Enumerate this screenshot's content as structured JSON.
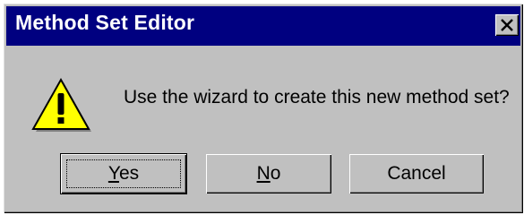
{
  "window": {
    "title": "Method Set Editor",
    "close_icon": "close-icon"
  },
  "dialog": {
    "icon": "warning-icon",
    "message": "Use the wizard to create this new method set?"
  },
  "buttons": {
    "yes": {
      "mnemonic": "Y",
      "rest": "es"
    },
    "no": {
      "mnemonic": "N",
      "rest": "o"
    },
    "cancel": {
      "label": "Cancel"
    }
  },
  "colors": {
    "titlebar": "#000080",
    "face": "#c0c0c0",
    "warning": "#ffff00"
  }
}
